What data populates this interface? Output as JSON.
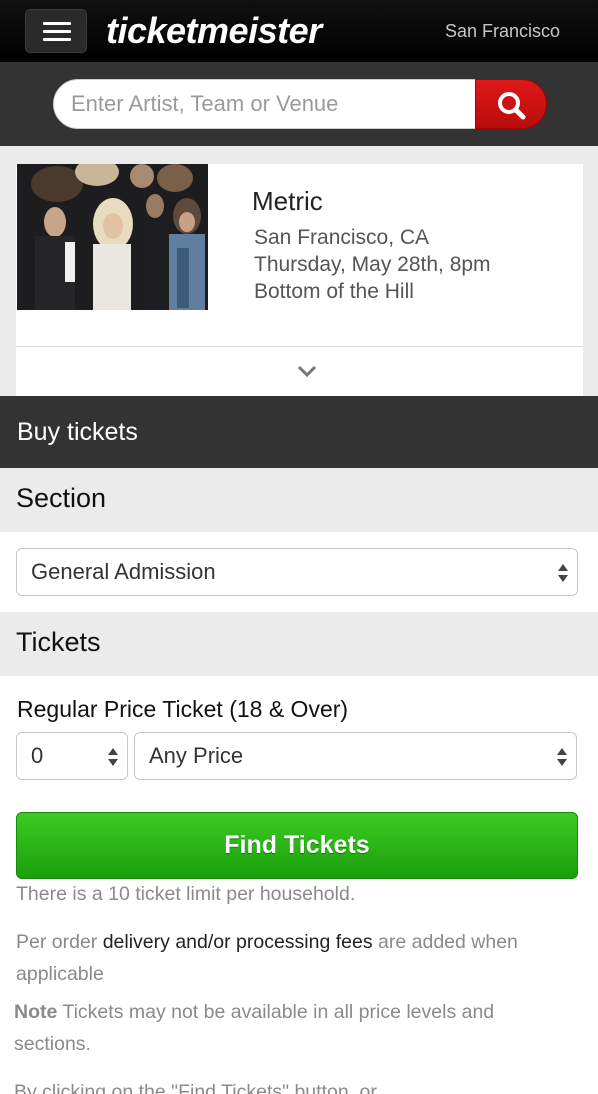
{
  "header": {
    "logo": "ticketmeister",
    "city": "San Francisco"
  },
  "search": {
    "placeholder": "Enter Artist, Team or Venue"
  },
  "event": {
    "title": "Metric",
    "location": "San Francisco, CA",
    "datetime": "Thursday, May 28th, 8pm",
    "venue": "Bottom of the Hill"
  },
  "buy": {
    "header": "Buy tickets",
    "section_label": "Section",
    "section_value": "General Admission",
    "tickets_label": "Tickets",
    "ticket_type": "Regular Price Ticket (18 & Over)",
    "quantity_value": "0",
    "price_value": "Any Price",
    "find_button": "Find Tickets"
  },
  "notes": {
    "limit": "There is a 10 ticket limit per household.",
    "fees_prefix": "Per order ",
    "fees_link": "delivery and/or processing fees",
    "fees_suffix": " are added when applicable",
    "availability_label": "Note",
    "availability_text": " Tickets may not be available in all price levels and sections.",
    "terms_partial": "By clicking on the \"Find Tickets\" button, or"
  },
  "colors": {
    "header_bg": "#000000",
    "bar_bg": "#333333",
    "search_button": "#d01010",
    "find_button": "#2bb816"
  }
}
